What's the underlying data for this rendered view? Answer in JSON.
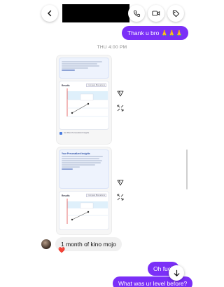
{
  "header": {
    "back_icon": "chevron-left-icon",
    "actions": [
      "phone-icon",
      "video-icon",
      "tag-icon"
    ]
  },
  "messages": {
    "sent_1": "Thank u bro 🙏🙏🙏",
    "timestamp": "THU 4:00 PM",
    "received_1": "1 month of kino mojo",
    "received_1_reaction": "❤️",
    "sent_2": "Oh fuck",
    "sent_3": "What was ur level before?"
  },
  "shared_screenshot_1": {
    "results_title": "Results",
    "tab_label": "Compare Biomarkers",
    "get_more": "Get More Personalized Insights"
  },
  "shared_screenshot_2": {
    "insight_title": "Your Personalized Insights",
    "results_title": "Results",
    "tab_label": "Compare Biomarkers"
  },
  "colors": {
    "sent_bubble": "#7b2ff7",
    "received_bubble": "#f0f0f0",
    "heart": "#e0245e"
  }
}
